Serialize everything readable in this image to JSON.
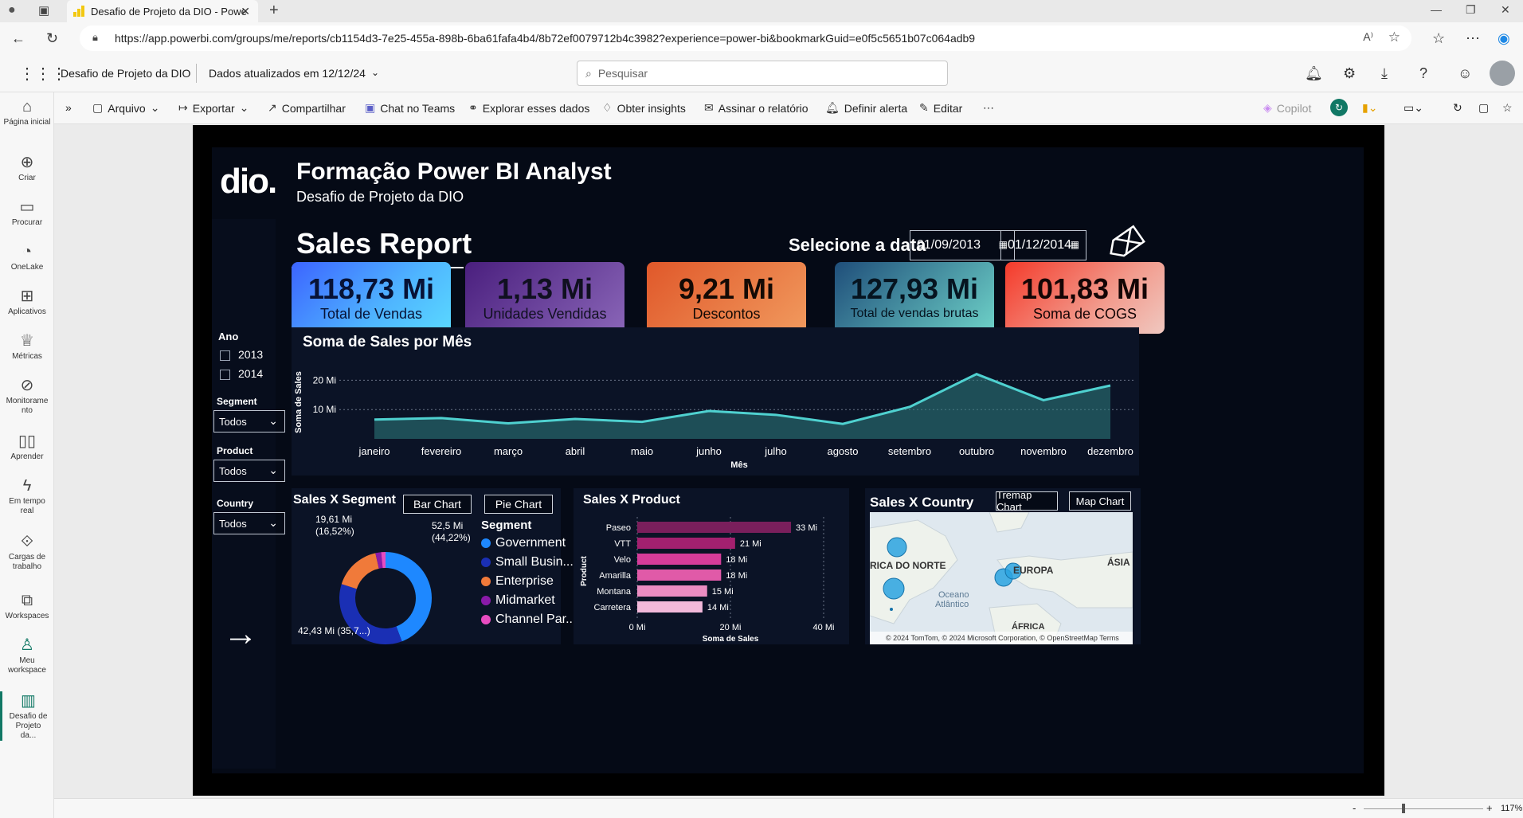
{
  "browser": {
    "tab_title": "Desafio de Projeto da DIO - Powe",
    "url": "https://app.powerbi.com/groups/me/reports/cb1154d3-7e25-455a-898b-6ba61fafa4b4/8b72ef0079712b4c3982?experience=power-bi&bookmarkGuid=e0f5c5651b07c064adb9"
  },
  "header": {
    "report_name": "Desafio de Projeto da DIO",
    "data_updated": "Dados atualizados em 12/12/24",
    "search_placeholder": "Pesquisar"
  },
  "left_rail": [
    {
      "label": "Página inicial",
      "icon": "home-icon"
    },
    {
      "label": "Criar",
      "icon": "plus-icon"
    },
    {
      "label": "Procurar",
      "icon": "folder-icon"
    },
    {
      "label": "OneLake",
      "icon": "onelake-icon"
    },
    {
      "label": "Aplicativos",
      "icon": "apps-icon"
    },
    {
      "label": "Métricas",
      "icon": "trophy-icon"
    },
    {
      "label": "Monitoramento",
      "icon": "monitor-icon"
    },
    {
      "label": "Aprender",
      "icon": "book-icon"
    },
    {
      "label": "Em tempo real",
      "icon": "lightning-icon"
    },
    {
      "label": "Cargas de trabalho",
      "icon": "workloads-icon"
    },
    {
      "label": "Workspaces",
      "icon": "workspaces-icon"
    },
    {
      "label": "Meu workspace",
      "icon": "person-icon"
    },
    {
      "label": "Desafio de Projeto da...",
      "icon": "report-icon"
    }
  ],
  "actions": {
    "arquivo": "Arquivo",
    "exportar": "Exportar",
    "compartilhar": "Compartilhar",
    "chat_teams": "Chat no Teams",
    "explorar": "Explorar esses dados",
    "insights": "Obter insights",
    "assinar": "Assinar o relatório",
    "alerta": "Definir alerta",
    "editar": "Editar",
    "copilot": "Copilot"
  },
  "report": {
    "logo_text": "dio.",
    "title": "Formação Power BI Analyst",
    "subtitle": "Desafio de Projeto da DIO",
    "page_title": "Sales Report",
    "date_label": "Selecione a data",
    "date_start": "01/09/2013",
    "date_end": "01/12/2014",
    "kpis": [
      {
        "value": "118,73 Mi",
        "label": "Total de Vendas"
      },
      {
        "value": "1,13 Mi",
        "label": "Unidades Vendidas"
      },
      {
        "value": "9,21 Mi",
        "label": "Descontos"
      },
      {
        "value": "127,93 Mi",
        "label": "Total de vendas brutas"
      },
      {
        "value": "101,83 Mi",
        "label": "Soma de COGS"
      }
    ],
    "filters": {
      "ano_label": "Ano",
      "years": [
        "2013",
        "2014"
      ],
      "segment_label": "Segment",
      "segment_value": "Todos",
      "product_label": "Product",
      "product_value": "Todos",
      "country_label": "Country",
      "country_value": "Todos"
    },
    "segment_chart": {
      "title": "Sales X Segment",
      "bar_button": "Bar Chart",
      "pie_button": "Pie Chart",
      "legend_title": "Segment",
      "labels": [
        "52,5 Mi",
        "(44,22%)",
        "42,43 Mi (35,7...)",
        "19,61 Mi",
        "(16,52%)"
      ]
    },
    "product_chart": {
      "title": "Sales X Product"
    },
    "country_chart": {
      "title": "Sales X Country",
      "treemap_button": "Tremap Chart",
      "map_button": "Map Chart",
      "map_labels": [
        "RICA DO NORTE",
        "EUROPA",
        "ÁSIA",
        "Oceano",
        "Atlântico",
        "ÁFRICA"
      ],
      "attribution": "© 2024 TomTom, © 2024 Microsoft Corporation, © OpenStreetMap  Terms"
    }
  },
  "status": {
    "zoom": "117%"
  },
  "chart_data": [
    {
      "type": "area",
      "title": "Soma de Sales por Mês",
      "xlabel": "Mês",
      "ylabel": "Soma de Sales",
      "categories": [
        "janeiro",
        "fevereiro",
        "março",
        "abril",
        "maio",
        "junho",
        "julho",
        "agosto",
        "setembro",
        "outubro",
        "novembro",
        "dezembro"
      ],
      "series": [
        {
          "values": [
            6.6,
            7.1,
            5.3,
            6.8,
            5.8,
            9.5,
            8.2,
            5.1,
            10.9,
            22.1,
            13.2,
            18.2
          ]
        }
      ],
      "y_ticks": [
        {
          "value": 10,
          "label": "10 Mi"
        },
        {
          "value": 20,
          "label": "20 Mi"
        }
      ],
      "ylim": [
        0,
        25
      ],
      "grid": true,
      "color": "#4fd1d0"
    },
    {
      "type": "pie",
      "title": "Sales X Segment",
      "legend_title": "Segment",
      "categories": [
        "Government",
        "Small Busin...",
        "Enterprise",
        "Midmarket",
        "Channel Par..."
      ],
      "values": [
        52.5,
        42.43,
        19.61,
        2.38,
        1.8
      ],
      "colors": [
        "#1e88ff",
        "#1a2fb4",
        "#f07a3a",
        "#8a1aa8",
        "#e84cc0"
      ]
    },
    {
      "type": "bar",
      "title": "Sales X Product",
      "xlabel": "Soma de Sales",
      "ylabel": "Product",
      "categories": [
        "Paseo",
        "VTT",
        "Velo",
        "Amarilla",
        "Montana",
        "Carretera"
      ],
      "values": [
        33,
        21,
        18,
        18,
        15,
        14
      ],
      "value_labels": [
        "33 Mi",
        "21 Mi",
        "18 Mi",
        "18 Mi",
        "15 Mi",
        "14 Mi"
      ],
      "x_ticks": [
        {
          "value": 0,
          "label": "0 Mi"
        },
        {
          "value": 20,
          "label": "20 Mi"
        },
        {
          "value": 40,
          "label": "40 Mi"
        }
      ],
      "xlim": [
        0,
        40
      ],
      "colors": [
        "#7a1f5c",
        "#a3206f",
        "#d63c9a",
        "#e05aa8",
        "#eb8dc2",
        "#f2b9da"
      ]
    }
  ]
}
